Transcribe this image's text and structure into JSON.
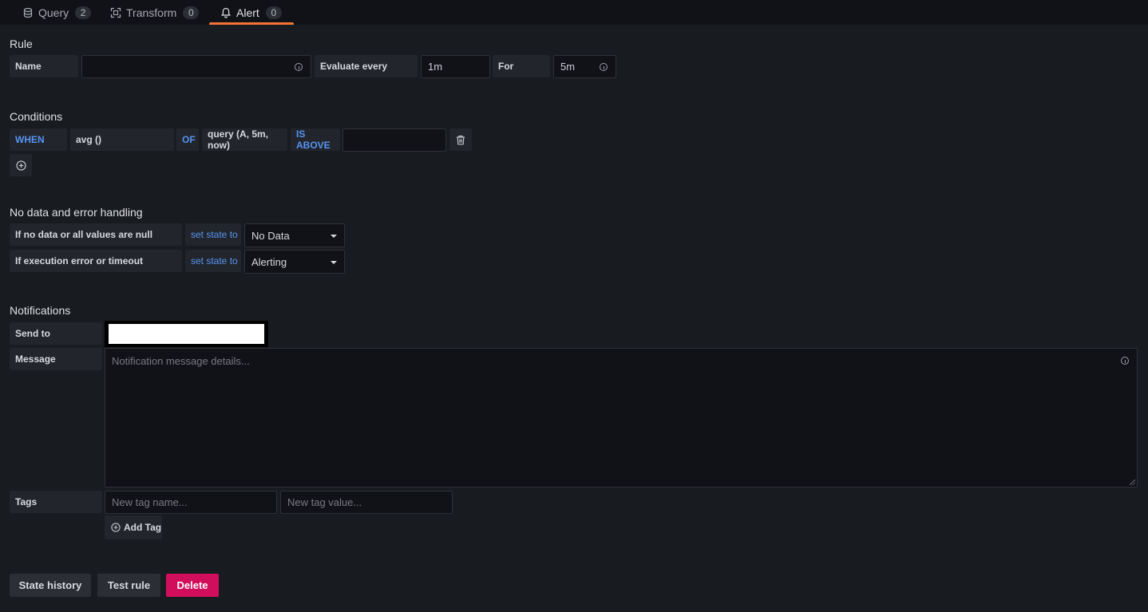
{
  "tabs": [
    {
      "label": "Query",
      "count": "2",
      "icon": "database-icon"
    },
    {
      "label": "Transform",
      "count": "0",
      "icon": "transform-icon"
    },
    {
      "label": "Alert",
      "count": "0",
      "icon": "bell-icon",
      "active": true
    }
  ],
  "colors": {
    "accent": "#f57335",
    "keyword": "#5794f2",
    "danger": "#d10e5c"
  },
  "rule": {
    "title": "Rule",
    "name_label": "Name",
    "name_value": "",
    "evaluate_label": "Evaluate every",
    "evaluate_value": "1m",
    "for_label": "For",
    "for_value": "5m"
  },
  "conditions": {
    "title": "Conditions",
    "when": "WHEN",
    "reducer": "avg ()",
    "of": "OF",
    "query": "query (A, 5m, now)",
    "evaluator": "IS ABOVE",
    "threshold": ""
  },
  "nodata": {
    "title": "No data and error handling",
    "rows": [
      {
        "label": "If no data or all values are null",
        "set": "set state to",
        "value": "No Data"
      },
      {
        "label": "If execution error or timeout",
        "set": "set state to",
        "value": "Alerting"
      }
    ]
  },
  "notifications": {
    "title": "Notifications",
    "send_to_label": "Send to",
    "message_label": "Message",
    "message_placeholder": "Notification message details...",
    "tags_label": "Tags",
    "tag_name_placeholder": "New tag name...",
    "tag_value_placeholder": "New tag value...",
    "add_tag": "Add Tag"
  },
  "actions": {
    "state_history": "State history",
    "test_rule": "Test rule",
    "delete": "Delete"
  }
}
